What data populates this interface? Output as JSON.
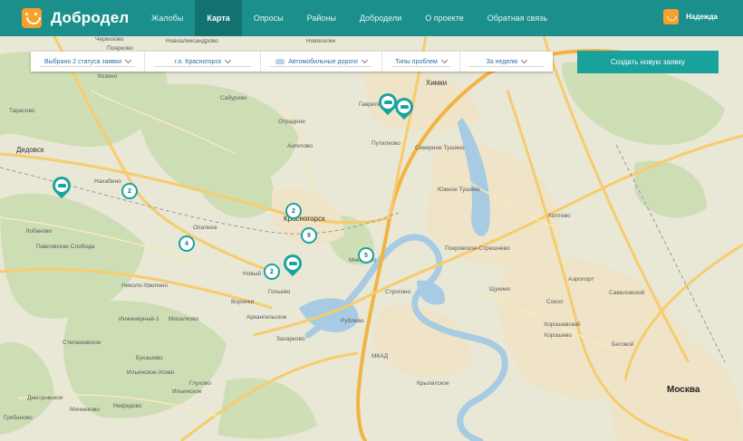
{
  "header": {
    "brand": "Добродел",
    "nav": [
      "Жалобы",
      "Карта",
      "Опросы",
      "Районы",
      "Добродели",
      "О проекте",
      "Обратная связь"
    ],
    "active_nav": "Карта",
    "user_name": "Надежда"
  },
  "filters": {
    "status": "Выбрано 2 статуса заявки",
    "district": "г.о. Красногорск",
    "category": "Автомобильные дороги",
    "problem_types": "Типы проблем",
    "period": "За неделю"
  },
  "create_button": "Создать новую заявку",
  "map": {
    "labels": [
      "Черкизово",
      "Поярково",
      "Новоалександрово",
      "Новоселки",
      "Козино",
      "Сабурово",
      "Химки",
      "Гаврилково",
      "Тарасово",
      "Дедовск",
      "Отрадное",
      "Путилково",
      "Ангелово",
      "Нахабино",
      "Опалиха",
      "Красногорск",
      "Павловская Слобода",
      "Лобаново",
      "Новый",
      "Гольево",
      "Николо-Урюпино",
      "Воронки",
      "Архангельское",
      "Инженерный-1",
      "Михалково",
      "Захарково",
      "Рублево",
      "Степановское",
      "Ильинское-Усово",
      "Ильинское",
      "Букашево",
      "Дмитровское",
      "Грибаново",
      "Мечниково",
      "Глухово",
      "Нефедово",
      "Северное Тушино",
      "Южное Тушино",
      "Строгино",
      "Щукино",
      "Хорошево",
      "Коптево",
      "Покровское-Стрешнево",
      "Крылатское",
      "Мякинино",
      "Москва",
      "МКАД",
      "Аэропорт",
      "Беговой",
      "Савеловский",
      "Сокол",
      "Хорошевский"
    ],
    "clusters": [
      "2",
      "2",
      "9",
      "4",
      "5",
      "2"
    ]
  },
  "colors": {
    "header": "#1a8f8c",
    "accent": "#19a19c",
    "brand_logo": "#f7a12b"
  }
}
